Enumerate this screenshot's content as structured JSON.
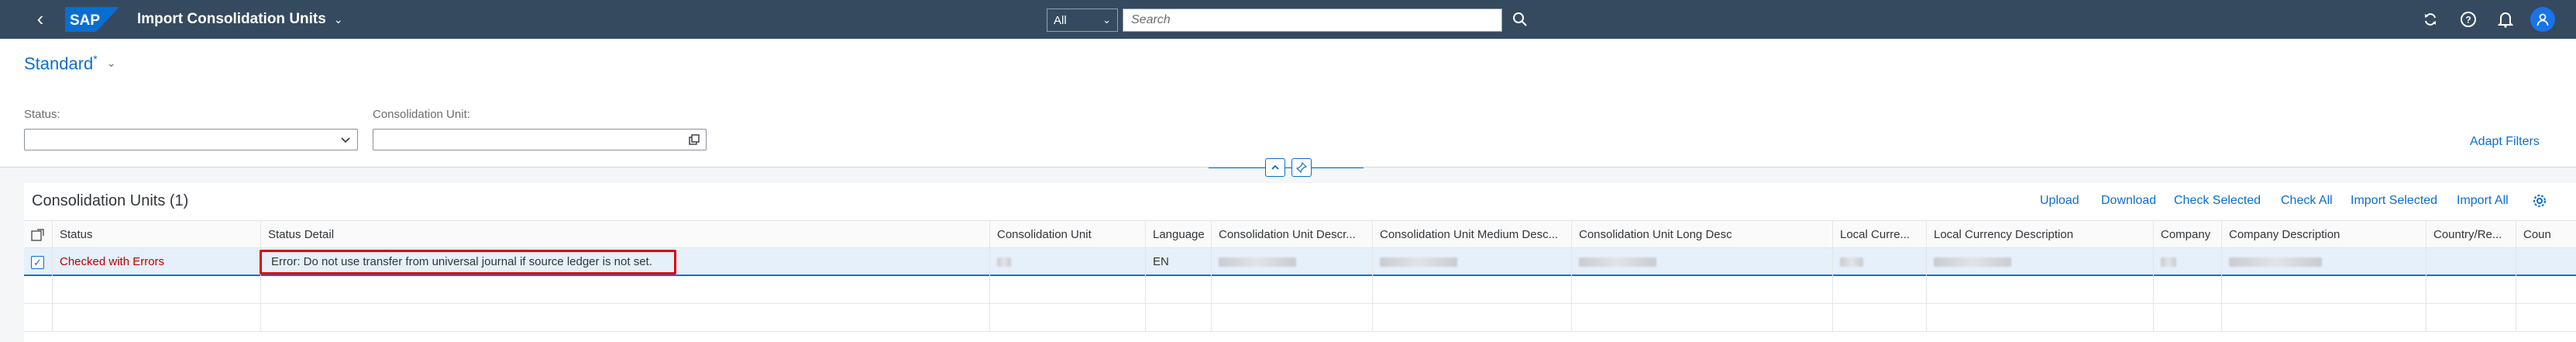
{
  "shell": {
    "app_title": "Import Consolidation Units",
    "search_scope": "All",
    "search_placeholder": "Search",
    "icons": [
      "back-icon",
      "sap-logo",
      "chevron-down-icon",
      "search-icon",
      "sync-icon",
      "help-icon",
      "bell-icon",
      "user-icon"
    ]
  },
  "header": {
    "variant": "Standard",
    "variant_modified": "*",
    "filters": [
      {
        "label": "Status:",
        "value": ""
      },
      {
        "label": "Consolidation Unit:",
        "value": ""
      }
    ],
    "adapt_filters": "Adapt Filters"
  },
  "table": {
    "title": "Consolidation Units (1)",
    "actions": [
      "Upload",
      "Download",
      "Check Selected",
      "Check All",
      "Import Selected",
      "Import All"
    ],
    "columns": [
      "Status",
      "Status Detail",
      "Consolidation Unit",
      "Language",
      "Consolidation Unit Descr...",
      "Consolidation Unit Medium Desc...",
      "Consolidation Unit Long Desc",
      "Local Curre...",
      "Local Currency Description",
      "Company",
      "Company Description",
      "Country/Re...",
      "Coun"
    ],
    "rows": [
      {
        "selected": true,
        "status": "Checked with Errors",
        "status_detail": "Error: Do not use transfer from universal journal if source ledger is not set.",
        "language": "EN"
      }
    ]
  },
  "colors": {
    "shell_bg": "#354a5f",
    "accent": "#0a6ed1",
    "error": "#bb0000",
    "highlight_box": "#e00000"
  }
}
